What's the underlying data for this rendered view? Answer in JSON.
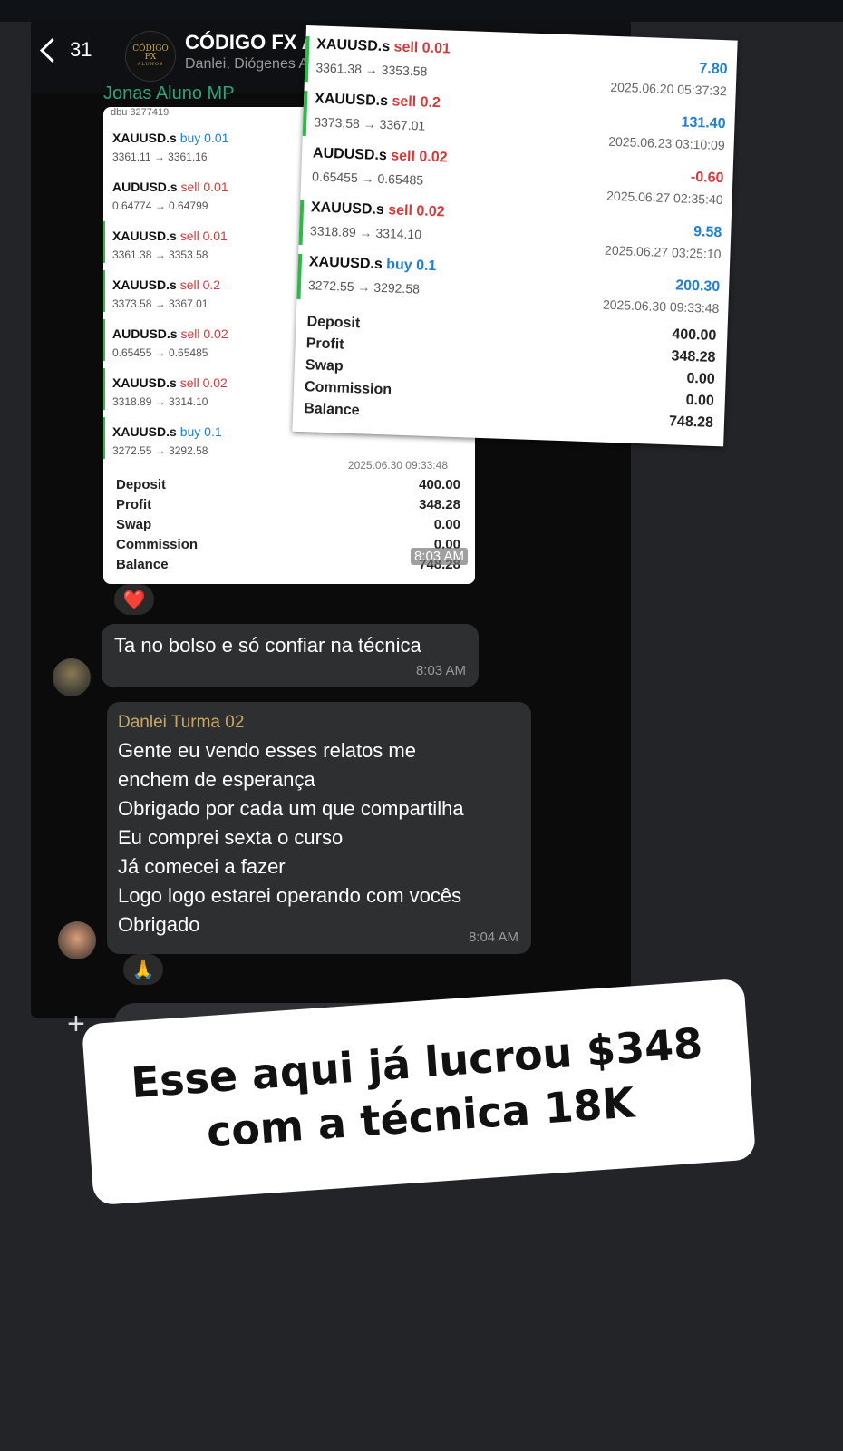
{
  "header": {
    "back_count": "31",
    "group_title": "CÓDIGO FX AL",
    "group_members": "Danlei, Diógenes Al",
    "avatar_text": [
      "CÓDIGO",
      "FX",
      "ALUNOS"
    ]
  },
  "sender_tag": "Jonas Aluno MP",
  "back_statement": {
    "header_partial": "dbu 3277419",
    "trades": [
      {
        "symbol": "XAUUSD.s",
        "side": "buy",
        "lot": "0.01",
        "prices": "3361.11 → 3361.16"
      },
      {
        "symbol": "AUDUSD.s",
        "side": "sell",
        "lot": "0.01",
        "prices": "0.64774 → 0.64799"
      },
      {
        "symbol": "XAUUSD.s",
        "side": "sell",
        "lot": "0.01",
        "prices": "3361.38 → 3353.58"
      },
      {
        "symbol": "XAUUSD.s",
        "side": "sell",
        "lot": "0.2",
        "prices": "3373.58 → 3367.01"
      },
      {
        "symbol": "AUDUSD.s",
        "side": "sell",
        "lot": "0.02",
        "prices": "0.65455 → 0.65485"
      },
      {
        "symbol": "XAUUSD.s",
        "side": "sell",
        "lot": "0.02",
        "prices": "3318.89 → 3314.10"
      },
      {
        "symbol": "XAUUSD.s",
        "side": "buy",
        "lot": "0.1",
        "prices": "3272.55 → 3292.58"
      }
    ],
    "last_time": "2025.06.30 09:33:48",
    "summary": [
      {
        "label": "Deposit",
        "value": "400.00"
      },
      {
        "label": "Profit",
        "value": "348.28"
      },
      {
        "label": "Swap",
        "value": "0.00"
      },
      {
        "label": "Commission",
        "value": "0.00"
      },
      {
        "label": "Balance",
        "value": "748.28"
      }
    ],
    "message_time": "8:03 AM"
  },
  "front_statement": {
    "trades": [
      {
        "symbol": "XAUUSD.s",
        "side": "sell",
        "lot": "0.01",
        "prices": "3361.38 → 3353.58",
        "pl": "7.80",
        "datetime": "2025.06.20 05:37:32"
      },
      {
        "symbol": "XAUUSD.s",
        "side": "sell",
        "lot": "0.2",
        "prices": "3373.58 → 3367.01",
        "pl": "131.40",
        "datetime": "2025.06.23 03:10:09"
      },
      {
        "symbol": "AUDUSD.s",
        "side": "sell",
        "lot": "0.02",
        "prices": "0.65455 → 0.65485",
        "pl": "-0.60",
        "datetime": "2025.06.27 02:35:40"
      },
      {
        "symbol": "XAUUSD.s",
        "side": "sell",
        "lot": "0.02",
        "prices": "3318.89 → 3314.10",
        "pl": "9.58",
        "datetime": "2025.06.27 03:25:10"
      },
      {
        "symbol": "XAUUSD.s",
        "side": "buy",
        "lot": "0.1",
        "prices": "3272.55 → 3292.58",
        "pl": "200.30",
        "datetime": "2025.06.30 09:33:48"
      }
    ],
    "summary": [
      {
        "label": "Deposit",
        "value": "400.00"
      },
      {
        "label": "Profit",
        "value": "348.28"
      },
      {
        "label": "Swap",
        "value": "0.00"
      },
      {
        "label": "Commission",
        "value": "0.00"
      },
      {
        "label": "Balance",
        "value": "748.28"
      }
    ]
  },
  "reactions": {
    "first": "❤️",
    "second": "🙏"
  },
  "messages": [
    {
      "text": "Ta no bolso e só confiar na técnica",
      "time": "8:03 AM"
    },
    {
      "sender": "Danlei Turma 02",
      "lines": [
        "Gente eu vendo esses relatos me",
        "enchem de esperança",
        "Obrigado por cada um que compartilha",
        "Eu comprei sexta o curso",
        "Já comecei a fazer",
        "Logo logo estarei operando com vocês",
        "Obrigado"
      ],
      "time": "8:04 AM"
    }
  ],
  "input": {
    "plus": "+"
  },
  "caption": {
    "line1": "Esse aqui já lucrou $348",
    "line2": "com a técnica 18K"
  },
  "colors": {
    "sell": "#d23b3b",
    "buy": "#1f7fd1",
    "green_bar": "#2fb84a",
    "sender_tag": "#2fa37a",
    "sender_name": "#c8a866"
  }
}
